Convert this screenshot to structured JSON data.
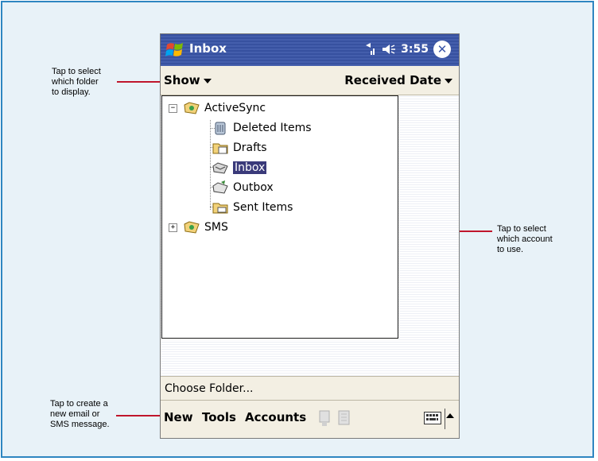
{
  "callouts": {
    "show_note": [
      "Tap to select",
      "which folder",
      "to display."
    ],
    "accounts_note": [
      "Tap to select",
      "which account",
      "to use."
    ],
    "new_note": [
      "Tap to create a",
      "new email or",
      "SMS message."
    ]
  },
  "titlebar": {
    "title": "Inbox",
    "time": "3:55"
  },
  "menubar": {
    "show_label": "Show",
    "sort_label": "Received Date"
  },
  "tree": {
    "root": "ActiveSync",
    "folders": [
      "Deleted Items",
      "Drafts",
      "Inbox",
      "Outbox",
      "Sent Items"
    ],
    "second_root": "SMS",
    "selected": "Inbox"
  },
  "choose_folder": "Choose Folder...",
  "commandbar": {
    "new_label": "New",
    "tools_label": "Tools",
    "accounts_label": "Accounts"
  },
  "colors": {
    "titlebar": "#3a55a8",
    "accent_line": "#c0162c",
    "frame": "#2e86c1"
  },
  "icons": [
    "windows-logo-icon",
    "signal-icon",
    "speaker-icon",
    "close-icon",
    "folder-icon",
    "keyboard-icon"
  ]
}
